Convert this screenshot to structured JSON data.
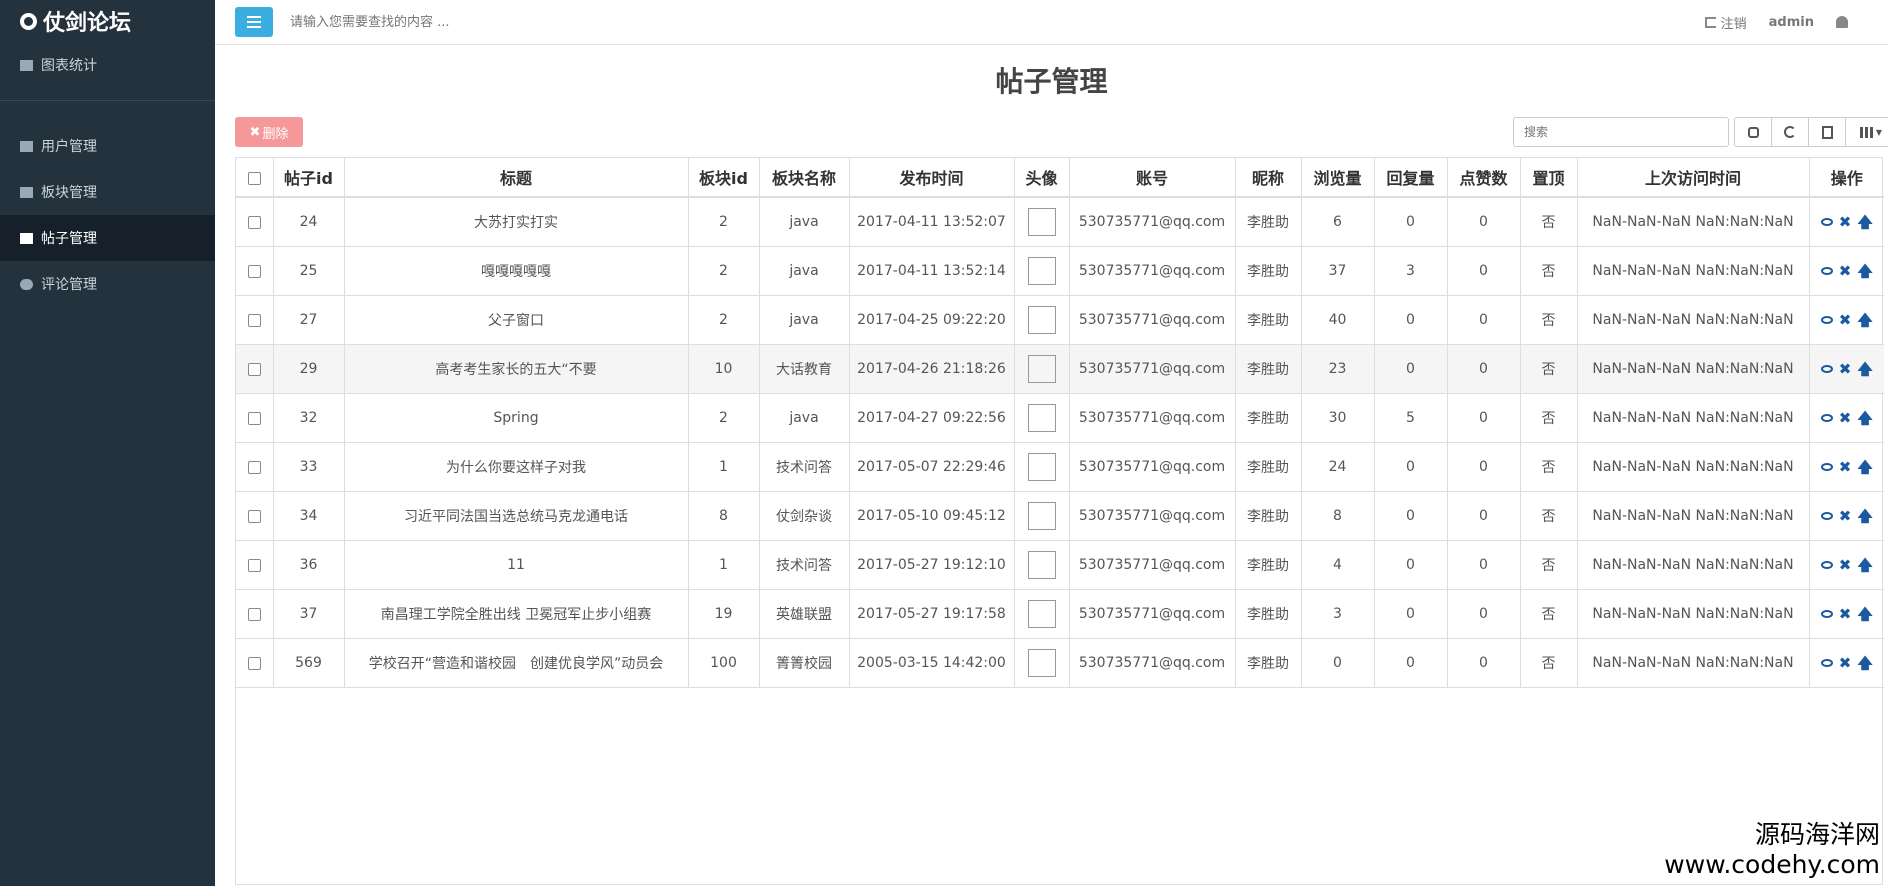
{
  "sidebar": {
    "brand": "仗剑论坛",
    "items": [
      {
        "label": "图表统计"
      },
      {
        "label": "用户管理"
      },
      {
        "label": "板块管理"
      },
      {
        "label": "帖子管理"
      },
      {
        "label": "评论管理"
      }
    ]
  },
  "topbar": {
    "search_placeholder": "请输入您需要查找的内容 ...",
    "logout": "注销",
    "user": "admin"
  },
  "page": {
    "title": "帖子管理",
    "delete_label": "删除",
    "table_search_placeholder": "搜索"
  },
  "table": {
    "columns": [
      "帖子id",
      "标题",
      "板块id",
      "板块名称",
      "发布时间",
      "头像",
      "账号",
      "昵称",
      "浏览量",
      "回复量",
      "点赞数",
      "置顶",
      "上次访问时间",
      "操作"
    ],
    "rows": [
      {
        "id": "24",
        "title": "大苏打实打实",
        "board_id": "2",
        "board_name": "java",
        "time": "2017-04-11 13:52:07",
        "account": "530735771@qq.com",
        "nick": "李胜助",
        "views": "6",
        "replies": "0",
        "likes": "0",
        "top": "否",
        "last": "NaN-NaN-NaN NaN:NaN:NaN"
      },
      {
        "id": "25",
        "title": "嘎嘎嘎嘎嘎",
        "board_id": "2",
        "board_name": "java",
        "time": "2017-04-11 13:52:14",
        "account": "530735771@qq.com",
        "nick": "李胜助",
        "views": "37",
        "replies": "3",
        "likes": "0",
        "top": "否",
        "last": "NaN-NaN-NaN NaN:NaN:NaN"
      },
      {
        "id": "27",
        "title": "父子窗口",
        "board_id": "2",
        "board_name": "java",
        "time": "2017-04-25 09:22:20",
        "account": "530735771@qq.com",
        "nick": "李胜助",
        "views": "40",
        "replies": "0",
        "likes": "0",
        "top": "否",
        "last": "NaN-NaN-NaN NaN:NaN:NaN"
      },
      {
        "id": "29",
        "title": "高考考生家长的五大“不要",
        "board_id": "10",
        "board_name": "大话教育",
        "time": "2017-04-26 21:18:26",
        "account": "530735771@qq.com",
        "nick": "李胜助",
        "views": "23",
        "replies": "0",
        "likes": "0",
        "top": "否",
        "last": "NaN-NaN-NaN NaN:NaN:NaN"
      },
      {
        "id": "32",
        "title": "Spring",
        "board_id": "2",
        "board_name": "java",
        "time": "2017-04-27 09:22:56",
        "account": "530735771@qq.com",
        "nick": "李胜助",
        "views": "30",
        "replies": "5",
        "likes": "0",
        "top": "否",
        "last": "NaN-NaN-NaN NaN:NaN:NaN"
      },
      {
        "id": "33",
        "title": "为什么你要这样子对我",
        "board_id": "1",
        "board_name": "技术问答",
        "time": "2017-05-07 22:29:46",
        "account": "530735771@qq.com",
        "nick": "李胜助",
        "views": "24",
        "replies": "0",
        "likes": "0",
        "top": "否",
        "last": "NaN-NaN-NaN NaN:NaN:NaN"
      },
      {
        "id": "34",
        "title": "习近平同法国当选总统马克龙通电话",
        "board_id": "8",
        "board_name": "仗剑杂谈",
        "time": "2017-05-10 09:45:12",
        "account": "530735771@qq.com",
        "nick": "李胜助",
        "views": "8",
        "replies": "0",
        "likes": "0",
        "top": "否",
        "last": "NaN-NaN-NaN NaN:NaN:NaN"
      },
      {
        "id": "36",
        "title": "11",
        "board_id": "1",
        "board_name": "技术问答",
        "time": "2017-05-27 19:12:10",
        "account": "530735771@qq.com",
        "nick": "李胜助",
        "views": "4",
        "replies": "0",
        "likes": "0",
        "top": "否",
        "last": "NaN-NaN-NaN NaN:NaN:NaN"
      },
      {
        "id": "37",
        "title": "南昌理工学院全胜出线 卫冕冠军止步小组赛",
        "board_id": "19",
        "board_name": "英雄联盟",
        "time": "2017-05-27 19:17:58",
        "account": "530735771@qq.com",
        "nick": "李胜助",
        "views": "3",
        "replies": "0",
        "likes": "0",
        "top": "否",
        "last": "NaN-NaN-NaN NaN:NaN:NaN"
      },
      {
        "id": "569",
        "title": "学校召开“营造和谐校园　创建优良学风”动员会",
        "board_id": "100",
        "board_name": "箐箐校园",
        "time": "2005-03-15 14:42:00",
        "account": "530735771@qq.com",
        "nick": "李胜助",
        "views": "0",
        "replies": "0",
        "likes": "0",
        "top": "否",
        "last": "NaN-NaN-NaN NaN:NaN:NaN"
      }
    ]
  },
  "watermark": {
    "line1": "源码海洋网",
    "line2": "www.codehy.com"
  }
}
